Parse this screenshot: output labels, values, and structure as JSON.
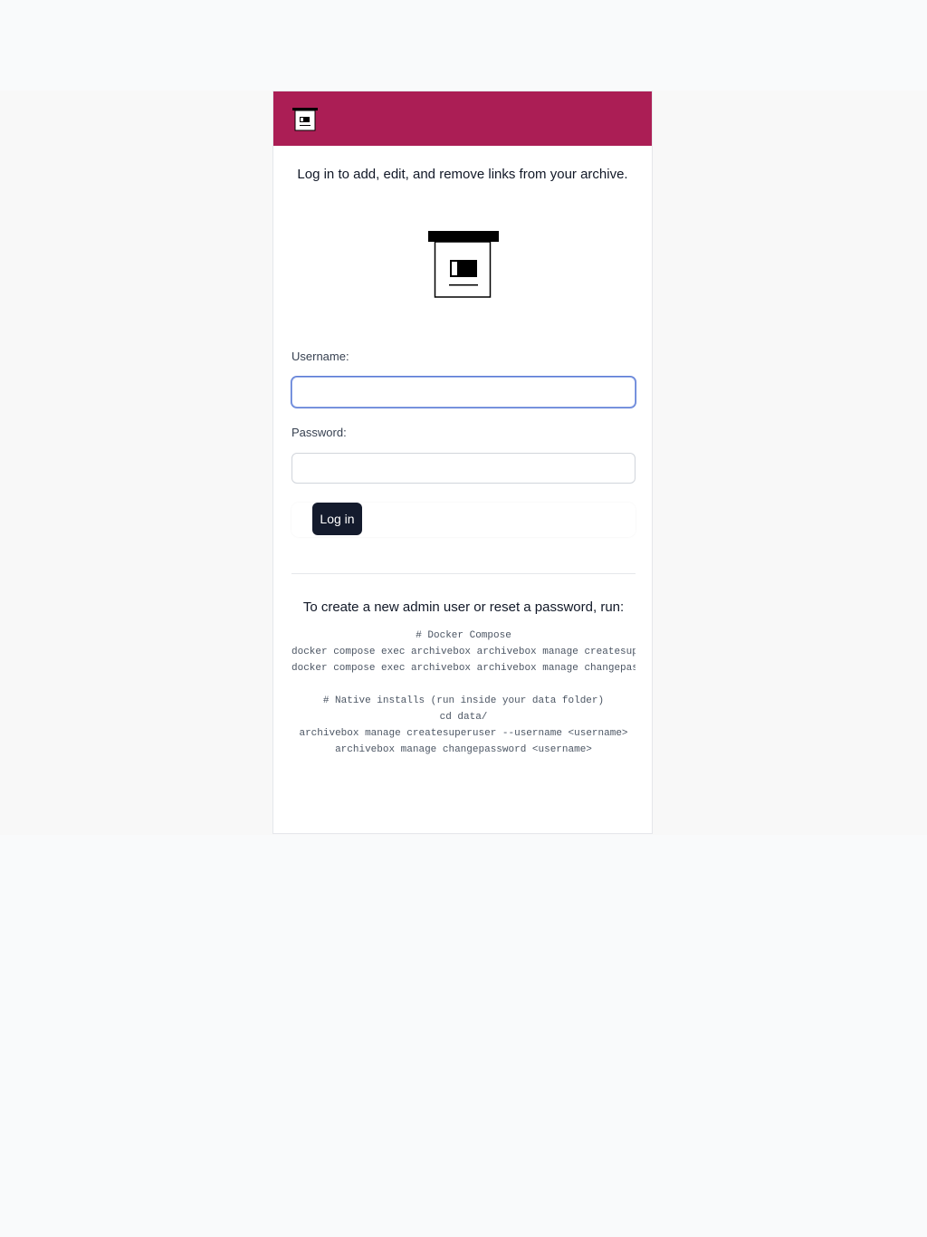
{
  "login": {
    "intro": "Log in to add, edit, and remove links from your archive.",
    "username_label": "Username:",
    "username_value": "",
    "password_label": "Password:",
    "password_value": "",
    "submit_label": "Log in"
  },
  "help": {
    "title": "To create a new admin user or reset a password, run:",
    "lines": [
      "# Docker Compose",
      "docker compose exec archivebox archivebox manage createsuperuser",
      "docker compose exec archivebox archivebox manage changepassword",
      "",
      "# Native installs (run inside your data folder)",
      "cd data/",
      "archivebox manage createsuperuser --username <username>",
      "archivebox manage changepassword <username>"
    ]
  },
  "colors": {
    "header": "#ab1e55",
    "button": "#141b2d"
  },
  "icons": {
    "header_logo": "archivebox-logo-icon",
    "main_logo": "archivebox-logo-icon"
  }
}
